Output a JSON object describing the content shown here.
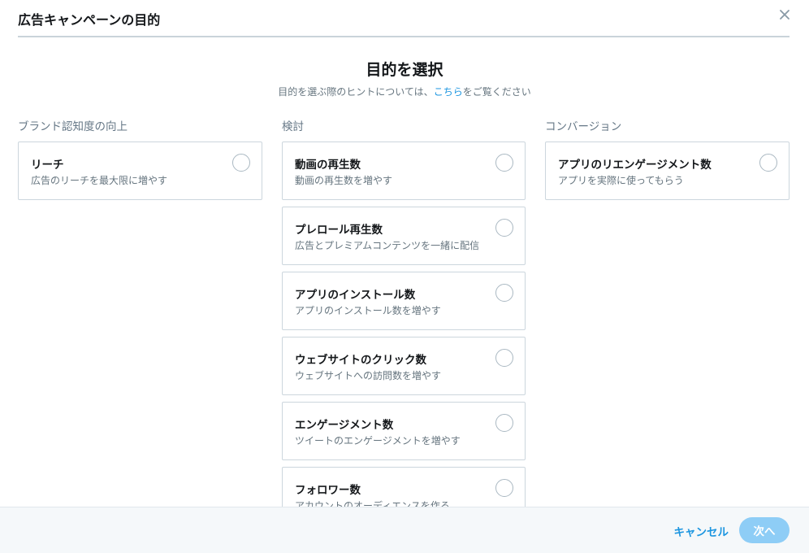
{
  "dialog": {
    "title": "広告キャンペーンの目的",
    "close_icon": "close-icon"
  },
  "main": {
    "heading": "目的を選択",
    "subtext_prefix": "目的を選ぶ際のヒントについては、",
    "subtext_link": "こちら",
    "subtext_suffix": "をご覧ください"
  },
  "columns": [
    {
      "title": "ブランド認知度の向上",
      "options": [
        {
          "title": "リーチ",
          "desc": "広告のリーチを最大限に増やす",
          "selected": false
        }
      ]
    },
    {
      "title": "検討",
      "options": [
        {
          "title": "動画の再生数",
          "desc": "動画の再生数を増やす",
          "selected": false
        },
        {
          "title": "プレロール再生数",
          "desc": "広告とプレミアムコンテンツを一緒に配信",
          "selected": false
        },
        {
          "title": "アプリのインストール数",
          "desc": "アプリのインストール数を増やす",
          "selected": false
        },
        {
          "title": "ウェブサイトのクリック数",
          "desc": "ウェブサイトへの訪問数を増やす",
          "selected": false
        },
        {
          "title": "エンゲージメント数",
          "desc": "ツイートのエンゲージメントを増やす",
          "selected": false
        },
        {
          "title": "フォロワー数",
          "desc": "アカウントのオーディエンスを作る",
          "selected": false
        }
      ]
    },
    {
      "title": "コンバージョン",
      "options": [
        {
          "title": "アプリのリエンゲージメント数",
          "desc": "アプリを実際に使ってもらう",
          "selected": false
        }
      ]
    }
  ],
  "footer": {
    "cancel_label": "キャンセル",
    "next_label": "次へ",
    "next_enabled": false
  },
  "colors": {
    "accent": "#1b95e0",
    "next_disabled_bg": "#8ecdf6",
    "card_border": "#ccd6dd"
  }
}
